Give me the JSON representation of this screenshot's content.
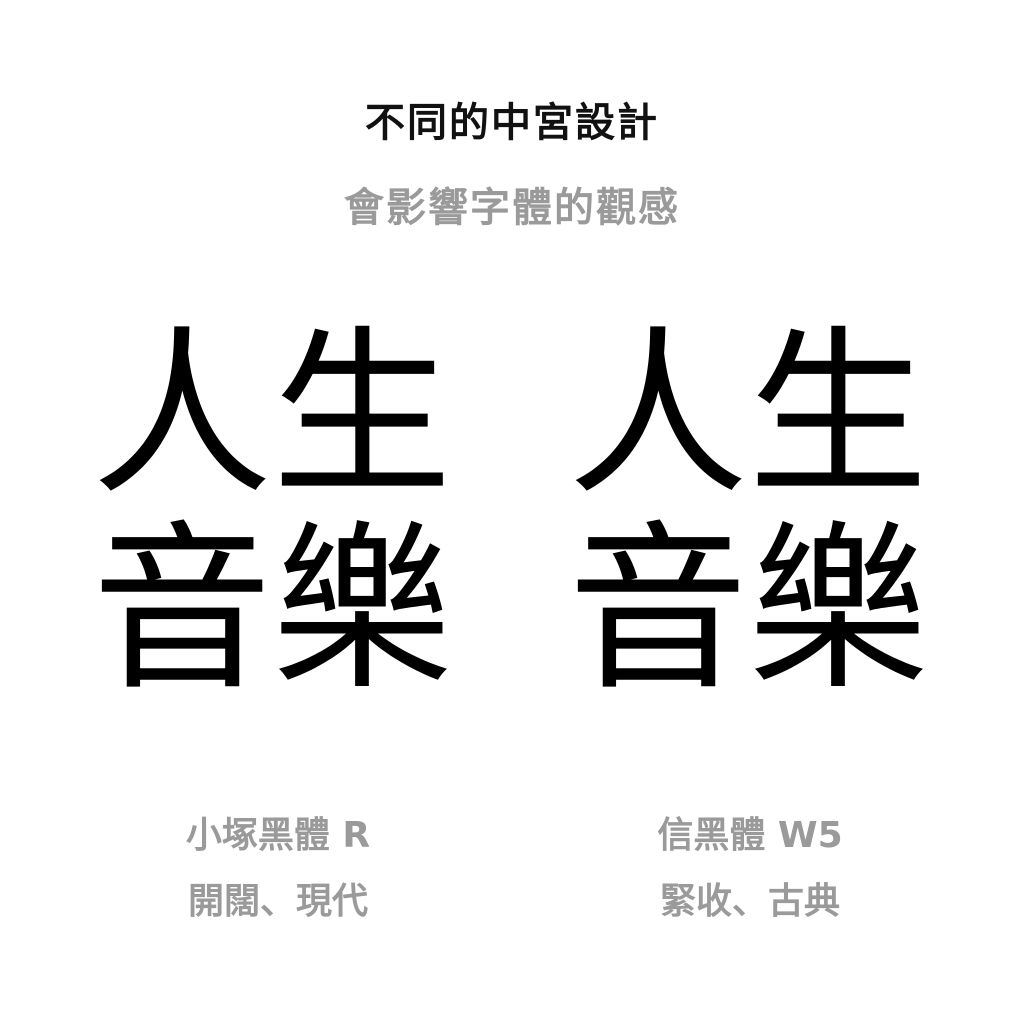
{
  "title": "不同的中宮設計",
  "subtitle": "會影響字體的觀感",
  "specimens": [
    {
      "row1": "人生",
      "row2": "音樂",
      "font_name": "小塚黑體 R",
      "description": "開闊、現代"
    },
    {
      "row1": "人生",
      "row2": "音樂",
      "font_name": "信黑體 W5",
      "description": "緊收、古典"
    }
  ],
  "colors": {
    "title": "#111111",
    "subtitle": "#9a9a9a",
    "specimen": "#000000",
    "caption": "#9a9a9a",
    "background": "#ffffff"
  }
}
